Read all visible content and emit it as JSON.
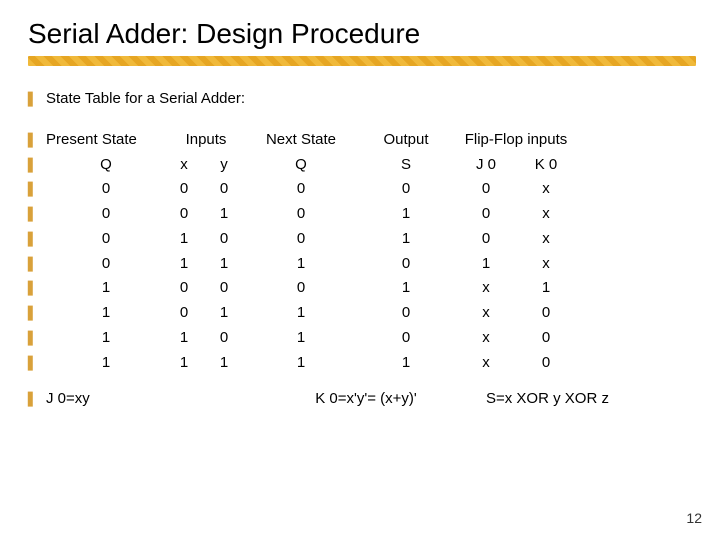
{
  "title": "Serial Adder: Design Procedure",
  "intro": "State Table for a Serial Adder:",
  "cols": {
    "present_state": "Present State",
    "inputs": "Inputs",
    "next_state": "Next State",
    "output": "Output",
    "flipflop": "Flip-Flop inputs",
    "q": "Q",
    "x": "x",
    "y": "y",
    "q2": "Q",
    "s": "S",
    "j0": "J 0",
    "k0": "K 0"
  },
  "rows": [
    {
      "q": "0",
      "x": "0",
      "y": "0",
      "nq": "0",
      "s": "0",
      "j": "0",
      "k": "x"
    },
    {
      "q": "0",
      "x": "0",
      "y": "1",
      "nq": "0",
      "s": "1",
      "j": "0",
      "k": "x"
    },
    {
      "q": "0",
      "x": "1",
      "y": "0",
      "nq": "0",
      "s": "1",
      "j": "0",
      "k": "x"
    },
    {
      "q": "0",
      "x": "1",
      "y": "1",
      "nq": "1",
      "s": "0",
      "j": "1",
      "k": "x"
    },
    {
      "q": "1",
      "x": "0",
      "y": "0",
      "nq": "0",
      "s": "1",
      "j": "x",
      "k": "1"
    },
    {
      "q": "1",
      "x": "0",
      "y": "1",
      "nq": "1",
      "s": "0",
      "j": "x",
      "k": "0"
    },
    {
      "q": "1",
      "x": "1",
      "y": "0",
      "nq": "1",
      "s": "0",
      "j": "x",
      "k": "0"
    },
    {
      "q": "1",
      "x": "1",
      "y": "1",
      "nq": "1",
      "s": "1",
      "j": "x",
      "k": "0"
    }
  ],
  "formulas": {
    "j": "J 0=xy",
    "k": "K 0=x'y'= (x+y)'",
    "s": "S=x XOR y XOR z"
  },
  "page": "12",
  "chart_data": {
    "type": "table",
    "title": "State Table for a Serial Adder",
    "columns": [
      "Present State Q",
      "Input x",
      "Input y",
      "Next State Q",
      "Output S",
      "J0",
      "K0"
    ],
    "rows": [
      [
        "0",
        "0",
        "0",
        "0",
        "0",
        "0",
        "x"
      ],
      [
        "0",
        "0",
        "1",
        "0",
        "1",
        "0",
        "x"
      ],
      [
        "0",
        "1",
        "0",
        "0",
        "1",
        "0",
        "x"
      ],
      [
        "0",
        "1",
        "1",
        "1",
        "0",
        "1",
        "x"
      ],
      [
        "1",
        "0",
        "0",
        "0",
        "1",
        "x",
        "1"
      ],
      [
        "1",
        "0",
        "1",
        "1",
        "0",
        "x",
        "0"
      ],
      [
        "1",
        "1",
        "0",
        "1",
        "0",
        "x",
        "0"
      ],
      [
        "1",
        "1",
        "1",
        "1",
        "1",
        "x",
        "0"
      ]
    ]
  }
}
